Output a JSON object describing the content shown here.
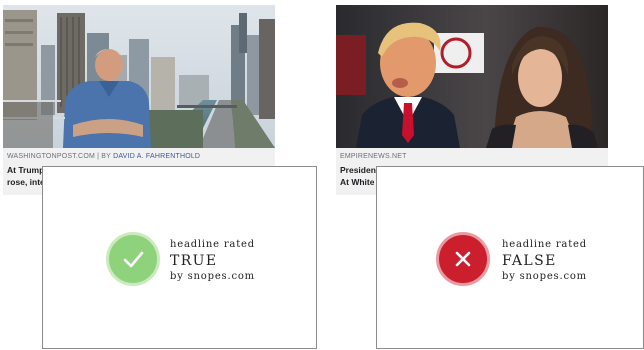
{
  "cards": [
    {
      "source": "WASHINGTONPOST.COM",
      "separator": " | BY ",
      "author": "DAVID A. FAHRENTHOLD",
      "headline_line1": "At Trump",
      "headline_line2": "rose, inte"
    },
    {
      "source": "EMPIRENEWS.NET",
      "headline_line1": "Presiden",
      "headline_line2": "At White"
    }
  ],
  "ratings": [
    {
      "prefix": "headline rated",
      "verdict": "TRUE",
      "suffix": "by snopes.com",
      "color": "#8fd27c",
      "icon": "check-icon"
    },
    {
      "prefix": "headline rated",
      "verdict": "FALSE",
      "suffix": "by snopes.com",
      "color": "#cc1f2e",
      "icon": "x-icon"
    }
  ]
}
